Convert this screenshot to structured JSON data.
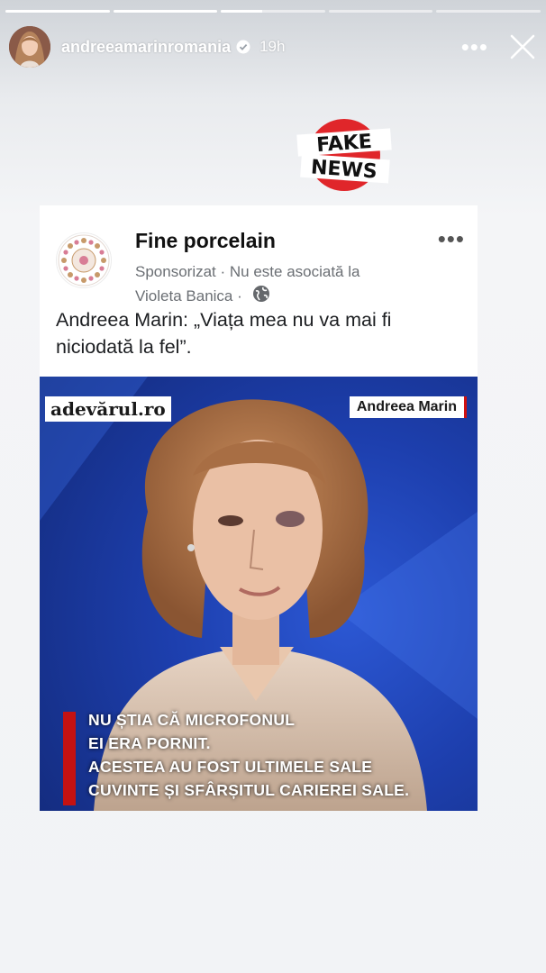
{
  "story": {
    "segments_total": 5,
    "segments_done": 2,
    "current_progress": 0.4
  },
  "header": {
    "username": "andreeamarinromania",
    "time": "19h"
  },
  "sticker": {
    "line1": "FAKE",
    "line2": "NEWS"
  },
  "post": {
    "page_name": "Fine porcelain",
    "meta_line1": "Sponsorizat · Nu este asociată la",
    "meta_line2": "Violeta Banica ·",
    "text": "Andreea Marin: „Viața mea nu va mai fi niciodată la fel”.",
    "image": {
      "brand": "adevărul.ro",
      "name_tag": "Andreea Marin",
      "caption": [
        "NU ȘTIA CĂ MICROFONUL",
        "EI ERA PORNIT.",
        "ACESTEA AU FOST ULTIMELE SALE",
        "CUVINTE ȘI SFÂRȘITUL CARIEREI SALE."
      ]
    }
  },
  "colors": {
    "sticker_red": "#e0262a",
    "caption_bar": "#c41212",
    "image_bg": "#1d3fae"
  }
}
